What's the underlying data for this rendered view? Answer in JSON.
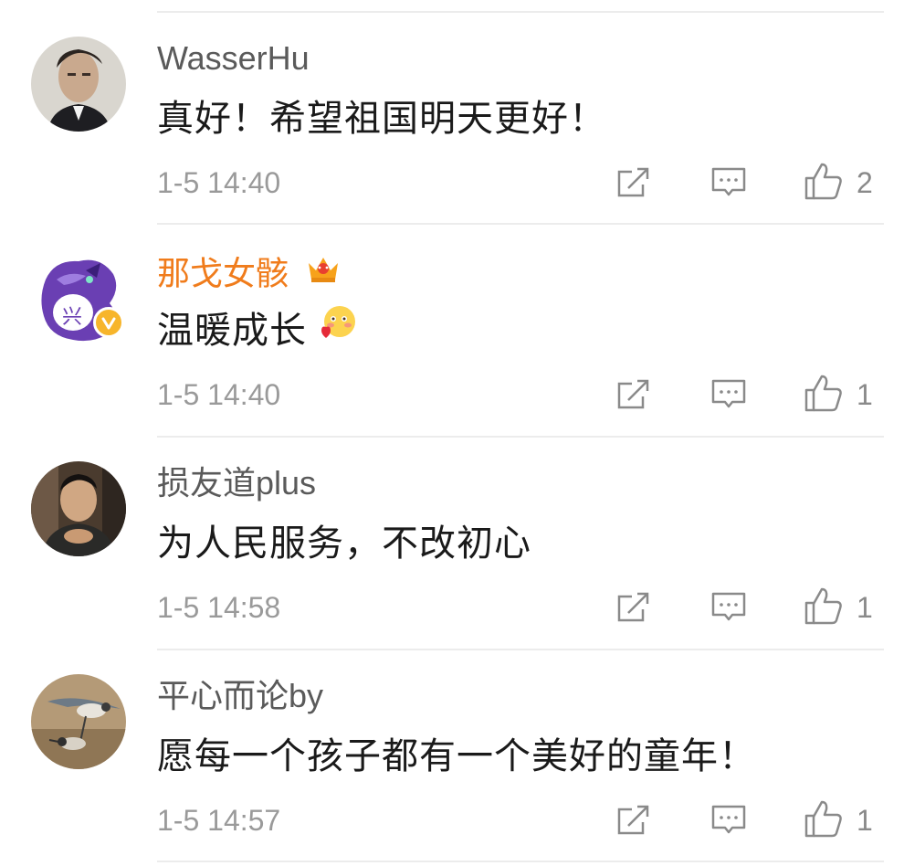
{
  "comments": [
    {
      "username": "WasserHu",
      "text": "真好！希望祖国明天更好！",
      "time": "1-5 14:40",
      "likes": "2",
      "username_color": "#5a5a5a"
    },
    {
      "username": "那戈女骸",
      "text": "温暖成长",
      "time": "1-5 14:40",
      "likes": "1",
      "username_color": "#f07c1c",
      "badges": [
        "crown-icon",
        "verified-badge-icon"
      ],
      "emoji": "blush-heart-emoji-icon"
    },
    {
      "username": "损友道plus",
      "text": "为人民服务，不改初心",
      "time": "1-5 14:58",
      "likes": "1",
      "username_color": "#5a5a5a"
    },
    {
      "username": "平心而论by",
      "text": "愿每一个孩子都有一个美好的童年！",
      "time": "1-5 14:57",
      "likes": "1",
      "username_color": "#5a5a5a"
    }
  ],
  "icons": {
    "repost": "repost-icon",
    "reply": "comment-icon",
    "like": "thumbs-up-icon"
  },
  "colors": {
    "username_highlight": "#f07c1c",
    "icon_gray": "#8a8a8a",
    "divider": "#ececec"
  }
}
